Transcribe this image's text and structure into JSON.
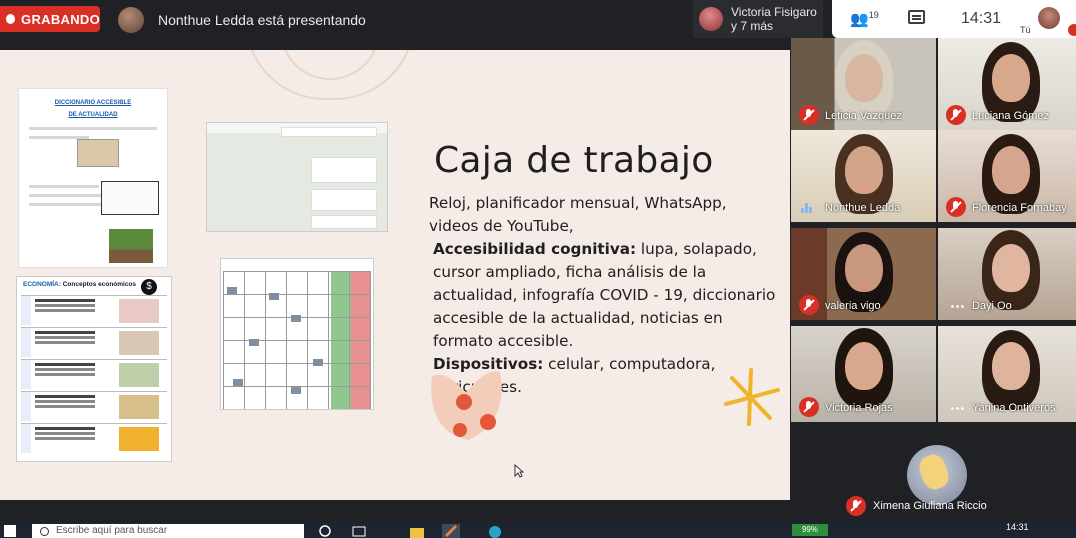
{
  "recording": {
    "label": "GRABANDO"
  },
  "presenter": {
    "text": "Nonthue Ledda está presentando"
  },
  "others": {
    "name": "Victoria Fisigaro",
    "more": "y 7 más"
  },
  "toolbar": {
    "people_count": "19",
    "time": "14:31",
    "self_label": "Tú"
  },
  "slide": {
    "title": "Caja de trabajo",
    "line1": "Reloj, planificador mensual, WhatsApp, videos de YouTube,",
    "cog_label": "Accesibilidad cognitiva:",
    "cog_text": " lupa, solapado, cursor ampliado, ficha análisis de la actualidad, infografía COVID - 19, diccionario accesible de la actualidad, noticias en formato accesible.",
    "dev_label": "Dispositivos:",
    "dev_text": " celular, computadora, auriculares.",
    "dict_title": "DICCIONARIO ACCESIBLE",
    "dict_title2": "DE ACTUALIDAD",
    "econ_title_prefix": "ECONOMÍA:",
    "econ_title": " Conceptos económicos"
  },
  "participants": [
    {
      "name": "Leticia Vazquez",
      "status": "muted"
    },
    {
      "name": "Luciana Gómez",
      "status": "muted"
    },
    {
      "name": "Nonthue Ledda",
      "status": "speaking"
    },
    {
      "name": "Florencia Fornabay",
      "status": "muted"
    },
    {
      "name": "valeria vigo",
      "status": "muted"
    },
    {
      "name": "Dayi Oo",
      "status": "more"
    },
    {
      "name": "Victoria Rojas",
      "status": "muted"
    },
    {
      "name": "Yanina Ontiveros",
      "status": "more"
    }
  ],
  "bottom_participant": {
    "name": "Ximena Giuliana Riccio",
    "status": "muted"
  },
  "taskbar": {
    "search_placeholder": "Escribe aquí para buscar",
    "battery": "99%",
    "clock": "14:31"
  },
  "colors": {
    "record": "#d93025",
    "slide_bg": "#f6ece7",
    "meet_bg": "#202124",
    "accent_yellow": "#f0b429"
  }
}
